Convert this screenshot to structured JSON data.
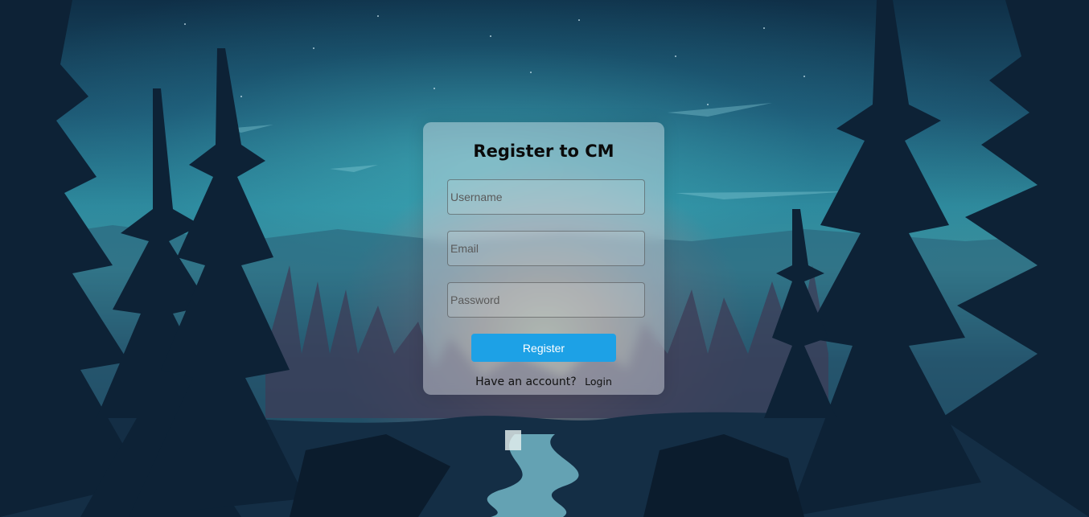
{
  "form": {
    "title": "Register to CM",
    "username_placeholder": "Username",
    "email_placeholder": "Email",
    "password_placeholder": "Password",
    "register_label": "Register",
    "account_prompt": "Have an account?",
    "login_label": "Login"
  },
  "colors": {
    "register_button": "#1da1e6",
    "card_background": "rgba(230,235,240,0.42)"
  }
}
